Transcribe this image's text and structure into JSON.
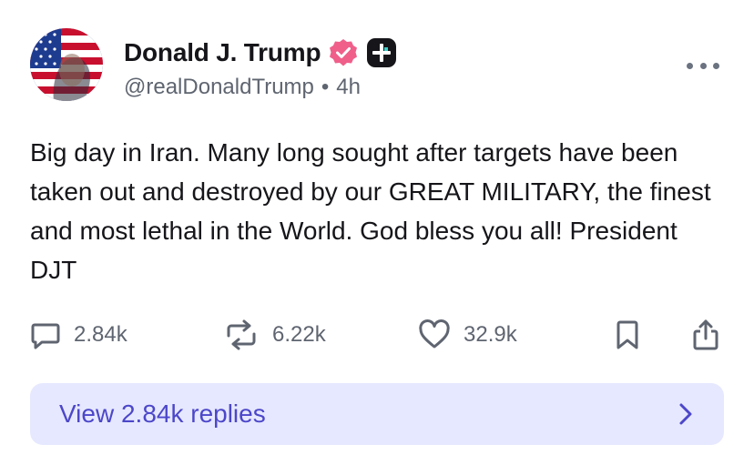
{
  "author": {
    "name": "Donald J. Trump",
    "handle": "@realDonaldTrump",
    "time": "4h",
    "avatar_icon": "flag-portrait-avatar",
    "verified_icon": "verified-badge-icon",
    "verified_color": "#ef5f8a",
    "plus_icon": "truth-plus-icon"
  },
  "post": {
    "text": "Big day in Iran. Many long sought after targets have been taken out and destroyed by our GREAT MILITARY, the finest and most lethal in the World. God bless you all! President DJT"
  },
  "actions": {
    "replies": "2.84k",
    "retruths": "6.22k",
    "likes": "32.9k",
    "icons": [
      "comment-icon",
      "retruth-icon",
      "heart-icon",
      "bookmark-icon",
      "share-icon"
    ]
  },
  "replies_button": {
    "label": "View 2.84k replies",
    "background": "#e6e8ff",
    "text_color": "#4c47c9"
  },
  "more_icon": "more-options-icon"
}
